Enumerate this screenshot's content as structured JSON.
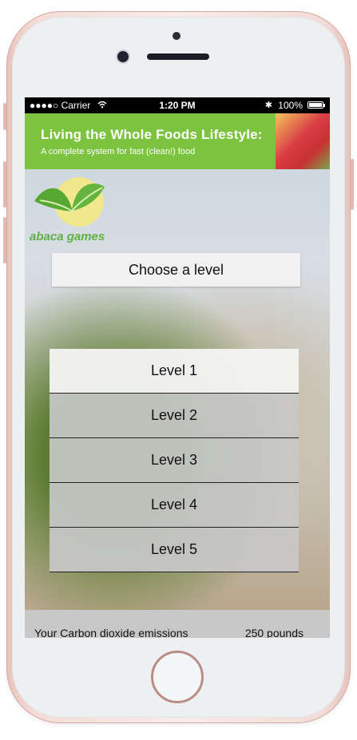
{
  "status_bar": {
    "signal": "●●●●○ Carrier",
    "time": "1:20 PM",
    "battery": "100%"
  },
  "banner": {
    "title": "Living the Whole Foods Lifestyle:",
    "subtitle": "A complete system for fast (clean!) food"
  },
  "logo": {
    "text": "abaca games"
  },
  "main": {
    "choose_label": "Choose a level",
    "levels": [
      {
        "label": "Level 1"
      },
      {
        "label": "Level 2"
      },
      {
        "label": "Level 3"
      },
      {
        "label": "Level 4"
      },
      {
        "label": "Level 5"
      }
    ]
  },
  "footer": {
    "label": "Your Carbon dioxide emissions",
    "value": "250 pounds"
  },
  "colors": {
    "banner_green": "#7cc33f",
    "phone_frame": "#f3dcd7",
    "logo_green": "#62b044"
  }
}
